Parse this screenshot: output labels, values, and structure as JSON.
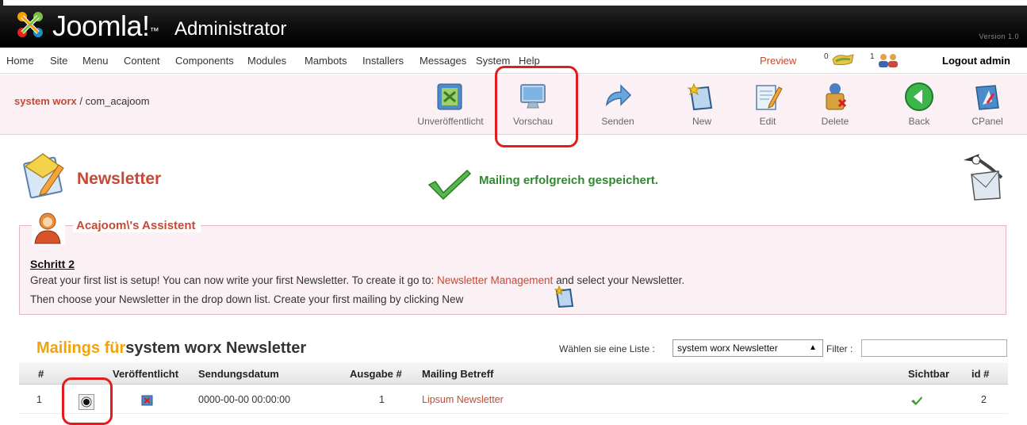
{
  "header": {
    "logo_text": "Joomla!",
    "tm": "™",
    "admin_text": "Administrator",
    "version": "Version 1.0"
  },
  "menu": {
    "items": [
      "Home",
      "Site",
      "Menu",
      "Content",
      "Components",
      "Modules",
      "Mambots",
      "Installers",
      "Messages",
      "System",
      "Help"
    ],
    "preview": "Preview",
    "messages_count": "0",
    "users_count": "1",
    "logout": "Logout admin"
  },
  "breadcrumb": {
    "site": "system worx",
    "sep": " / ",
    "component": "com_acajoom"
  },
  "toolbar": {
    "unpublish": "Unveröffentlicht",
    "preview": "Vorschau",
    "send": "Senden",
    "new": "New",
    "edit": "Edit",
    "delete": "Delete",
    "back": "Back",
    "cpanel": "CPanel"
  },
  "page": {
    "title": "Newsletter",
    "message": "Mailing erfolgreich gespeichert."
  },
  "assistant": {
    "legend": "Acajoom\\'s Assistent",
    "step": "Schritt 2",
    "line1_pre": "Great your first list is setup! You can now write your first Newsletter. To create it go to: ",
    "line1_link": "Newsletter Management",
    "line1_post": " and select your Newsletter.",
    "line2": "Then choose your Newsletter in the drop down list. Create your first mailing by clicking New"
  },
  "mailings": {
    "title_prefix": "Mailings für",
    "title_list": "system worx Newsletter",
    "choose_label": "Wählen sie eine Liste :",
    "selected_list": "system worx Newsletter",
    "filter_label": "Filter :",
    "filter_value": "",
    "columns": {
      "num": "#",
      "published": "Veröffentlicht",
      "date": "Sendungsdatum",
      "issue": "Ausgabe #",
      "subject": "Mailing Betreff",
      "visible": "Sichtbar",
      "id": "id #"
    },
    "rows": [
      {
        "num": "1",
        "date": "0000-00-00 00:00:00",
        "issue": "1",
        "subject": "Lipsum Newsletter",
        "id": "2"
      }
    ]
  },
  "colors": {
    "accent": "#c64934",
    "highlight": "#e01c1c",
    "orange": "#f0a30a",
    "success": "#2f8a2f"
  }
}
